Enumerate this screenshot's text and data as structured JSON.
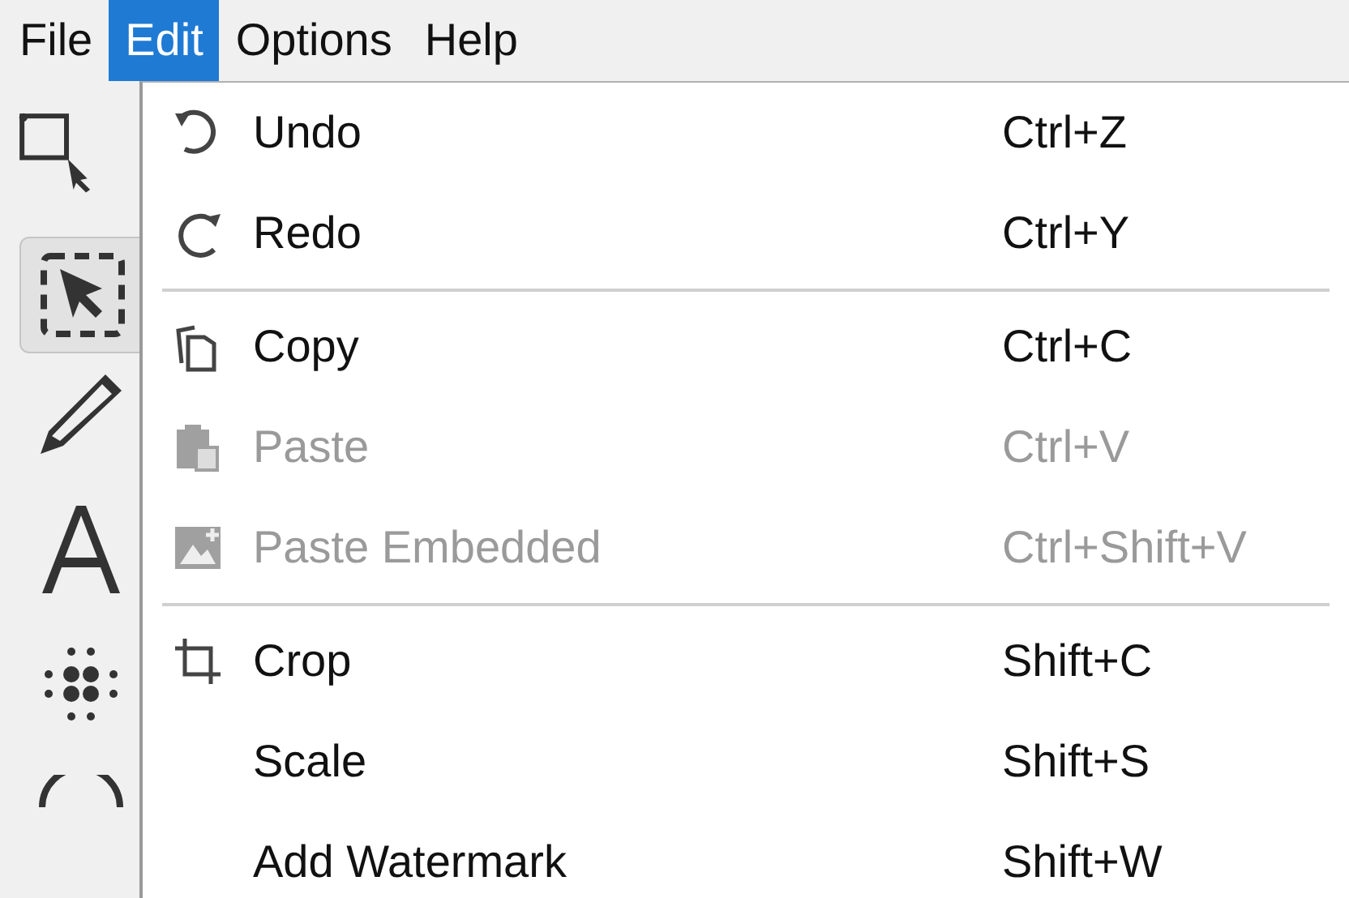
{
  "menubar": [
    {
      "label": "File",
      "selected": false
    },
    {
      "label": "Edit",
      "selected": true
    },
    {
      "label": "Options",
      "selected": false
    },
    {
      "label": "Help",
      "selected": false
    }
  ],
  "toolbar": [
    {
      "selected": false
    },
    {
      "selected": true
    },
    {
      "selected": false
    },
    {
      "selected": false
    },
    {
      "selected": false
    },
    {
      "selected": false
    }
  ],
  "edit_menu": [
    {
      "kind": "item",
      "label": "Undo",
      "shortcut": "Ctrl+Z",
      "disabled": false
    },
    {
      "kind": "item",
      "label": "Redo",
      "shortcut": "Ctrl+Y",
      "disabled": false
    },
    {
      "kind": "separator"
    },
    {
      "kind": "item",
      "label": "Copy",
      "shortcut": "Ctrl+C",
      "disabled": false
    },
    {
      "kind": "item",
      "label": "Paste",
      "shortcut": "Ctrl+V",
      "disabled": true
    },
    {
      "kind": "item",
      "label": "Paste Embedded",
      "shortcut": "Ctrl+Shift+V",
      "disabled": true
    },
    {
      "kind": "separator"
    },
    {
      "kind": "item",
      "label": "Crop",
      "shortcut": "Shift+C",
      "disabled": false
    },
    {
      "kind": "item",
      "label": "Scale",
      "shortcut": "Shift+S",
      "disabled": false
    },
    {
      "kind": "item",
      "label": "Add Watermark",
      "shortcut": "Shift+W",
      "disabled": false
    }
  ]
}
